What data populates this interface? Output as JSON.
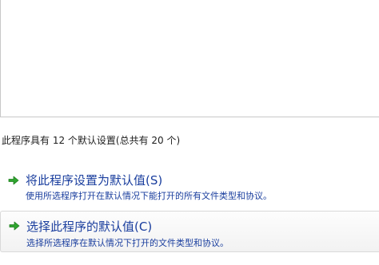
{
  "summary_text": "此程序具有 12 个默认设置(总共有 20 个)",
  "commands": [
    {
      "title": "将此程序设置为默认值(S)",
      "description": "使用所选程序打开在默认情况下能打开的所有文件类型和协议。",
      "icon": "green-arrow-icon"
    },
    {
      "title": "选择此程序的默认值(C)",
      "description": "选择所选程序在默认情况下打开的文件类型和协议。",
      "icon": "green-arrow-icon"
    }
  ],
  "colors": {
    "link": "#1a3e9e",
    "arrow": "#2fa52f"
  }
}
